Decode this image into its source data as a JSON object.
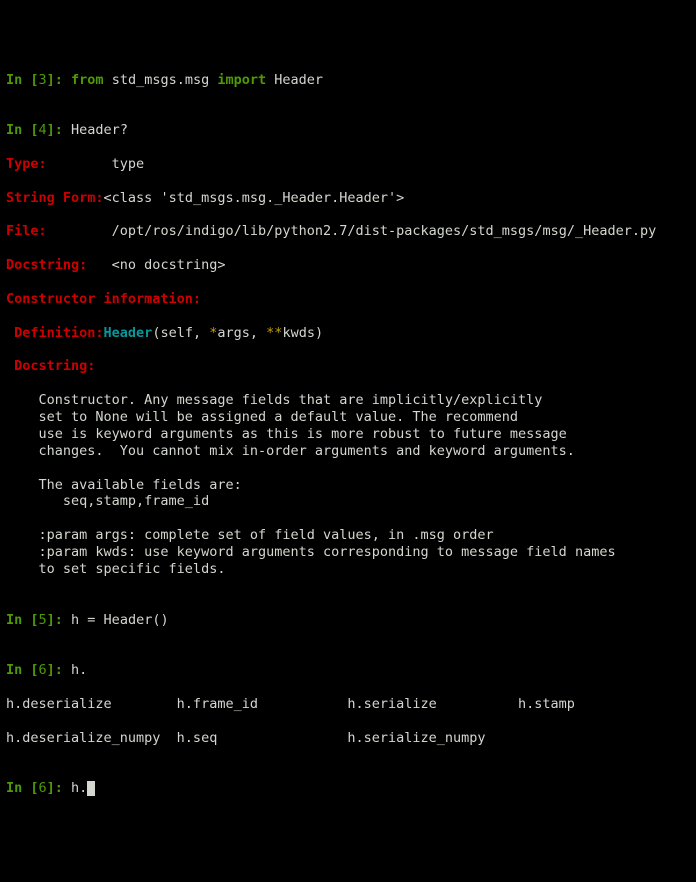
{
  "cells": {
    "c3": {
      "prompt_in": "In [",
      "num": "3",
      "prompt_close": "]: ",
      "kw_from": "from",
      "mod": " std_msgs.msg ",
      "kw_import": "import",
      "cls": " Header"
    },
    "c4": {
      "prompt_in": "In [",
      "num": "4",
      "prompt_close": "]: ",
      "query": "Header?",
      "type_label": "Type:",
      "type_pad": "        ",
      "type_val": "type",
      "sform_label": "String Form:",
      "sform_val": "<class 'std_msgs.msg._Header.Header'>",
      "file_label": "File:",
      "file_pad": "        ",
      "file_val": "/opt/ros/indigo/lib/python2.7/dist-packages/std_msgs/msg/_Header.py",
      "doc_label": "Docstring:",
      "doc_pad": "   ",
      "doc_val": "<no docstring>",
      "ctor_label": "Constructor information:",
      "def_label": " Definition:",
      "def_fn": "Header",
      "def_open": "(",
      "def_self": "self",
      "def_comma1": ", ",
      "def_star": "*",
      "def_args": "args",
      "def_comma2": ", ",
      "def_dstar": "**",
      "def_kwds": "kwds",
      "def_close": ")",
      "ds_label": " Docstring:",
      "body": "    Constructor. Any message fields that are implicitly/explicitly\n    set to None will be assigned a default value. The recommend\n    use is keyword arguments as this is more robust to future message\n    changes.  You cannot mix in-order arguments and keyword arguments.\n\n    The available fields are:\n       seq,stamp,frame_id\n\n    :param args: complete set of field values, in .msg order\n    :param kwds: use keyword arguments corresponding to message field names\n    to set specific fields."
    },
    "c5": {
      "prompt_in": "In [",
      "num": "5",
      "prompt_close": "]: ",
      "code": "h = Header()"
    },
    "c6a": {
      "prompt_in": "In [",
      "num": "6",
      "prompt_close": "]: ",
      "code": "h.",
      "comp_line1": "h.deserialize        h.frame_id           h.serialize          h.stamp",
      "comp_line2": "h.deserialize_numpy  h.seq                h.serialize_numpy"
    },
    "c6b": {
      "prompt_in": "In [",
      "num": "6",
      "prompt_close": "]: ",
      "code": "h."
    }
  }
}
